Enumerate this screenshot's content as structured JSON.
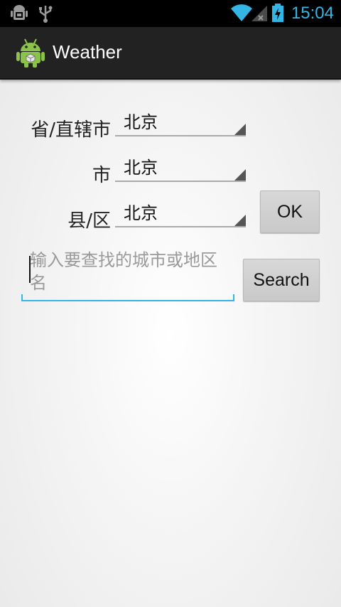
{
  "status_bar": {
    "time": "15:04",
    "icons": [
      "android-debug-icon",
      "usb-icon",
      "wifi-icon",
      "signal-icon",
      "battery-charging-icon"
    ],
    "accent_color": "#33b5e5"
  },
  "action_bar": {
    "title": "Weather",
    "icon": "android-app-icon"
  },
  "form": {
    "province_label": "省/直辖市",
    "province_value": "北京",
    "city_label": "市",
    "city_value": "北京",
    "county_label": "县/区",
    "county_value": "北京",
    "ok_label": "OK",
    "search_placeholder": "输入要查找的城市或地区名",
    "search_value": "",
    "search_label": "Search"
  }
}
